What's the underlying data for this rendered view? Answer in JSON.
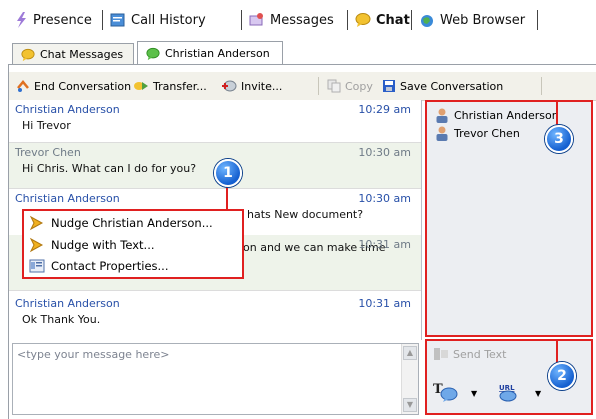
{
  "nav": {
    "presence": "Presence",
    "call_history": "Call History",
    "messages": "Messages",
    "chat": "Chat",
    "web_browser": "Web Browser"
  },
  "tabs": {
    "chat_messages": "Chat Messages",
    "christian_anderson": "Christian Anderson"
  },
  "toolbar": {
    "end_conversation": "End Conversation",
    "transfer": "Transfer...",
    "invite": "Invite...",
    "copy": "Copy",
    "save_conversation": "Save Conversation"
  },
  "messages": [
    {
      "sender": "Christian Anderson",
      "time": "10:29 am",
      "text": "Hi Trevor"
    },
    {
      "sender": "Trevor Chen",
      "time": "10:30 am",
      "text": "Hi Chris. What can I do for you?"
    },
    {
      "sender": "Christian Anderson",
      "time": "10:30 am",
      "text": "hats New document?"
    },
    {
      "sender": "",
      "time": "10:31 am",
      "text": "on and we can make time"
    },
    {
      "sender": "Christian Anderson",
      "time": "10:31 am",
      "text": "Ok Thank You."
    }
  ],
  "context_menu": {
    "nudge": "Nudge Christian Anderson...",
    "nudge_text": "Nudge with Text...",
    "contact_properties": "Contact Properties..."
  },
  "participants": [
    "Christian Anderson",
    "Trevor Chen"
  ],
  "compose": {
    "placeholder": "<type your message here>"
  },
  "send": {
    "send_text": "Send Text"
  },
  "callouts": {
    "one": "1",
    "two": "2",
    "three": "3"
  },
  "colors": {
    "accent_red": "#e02020",
    "sender_blue": "#2850a8",
    "badge_blue": "#1560d0"
  }
}
